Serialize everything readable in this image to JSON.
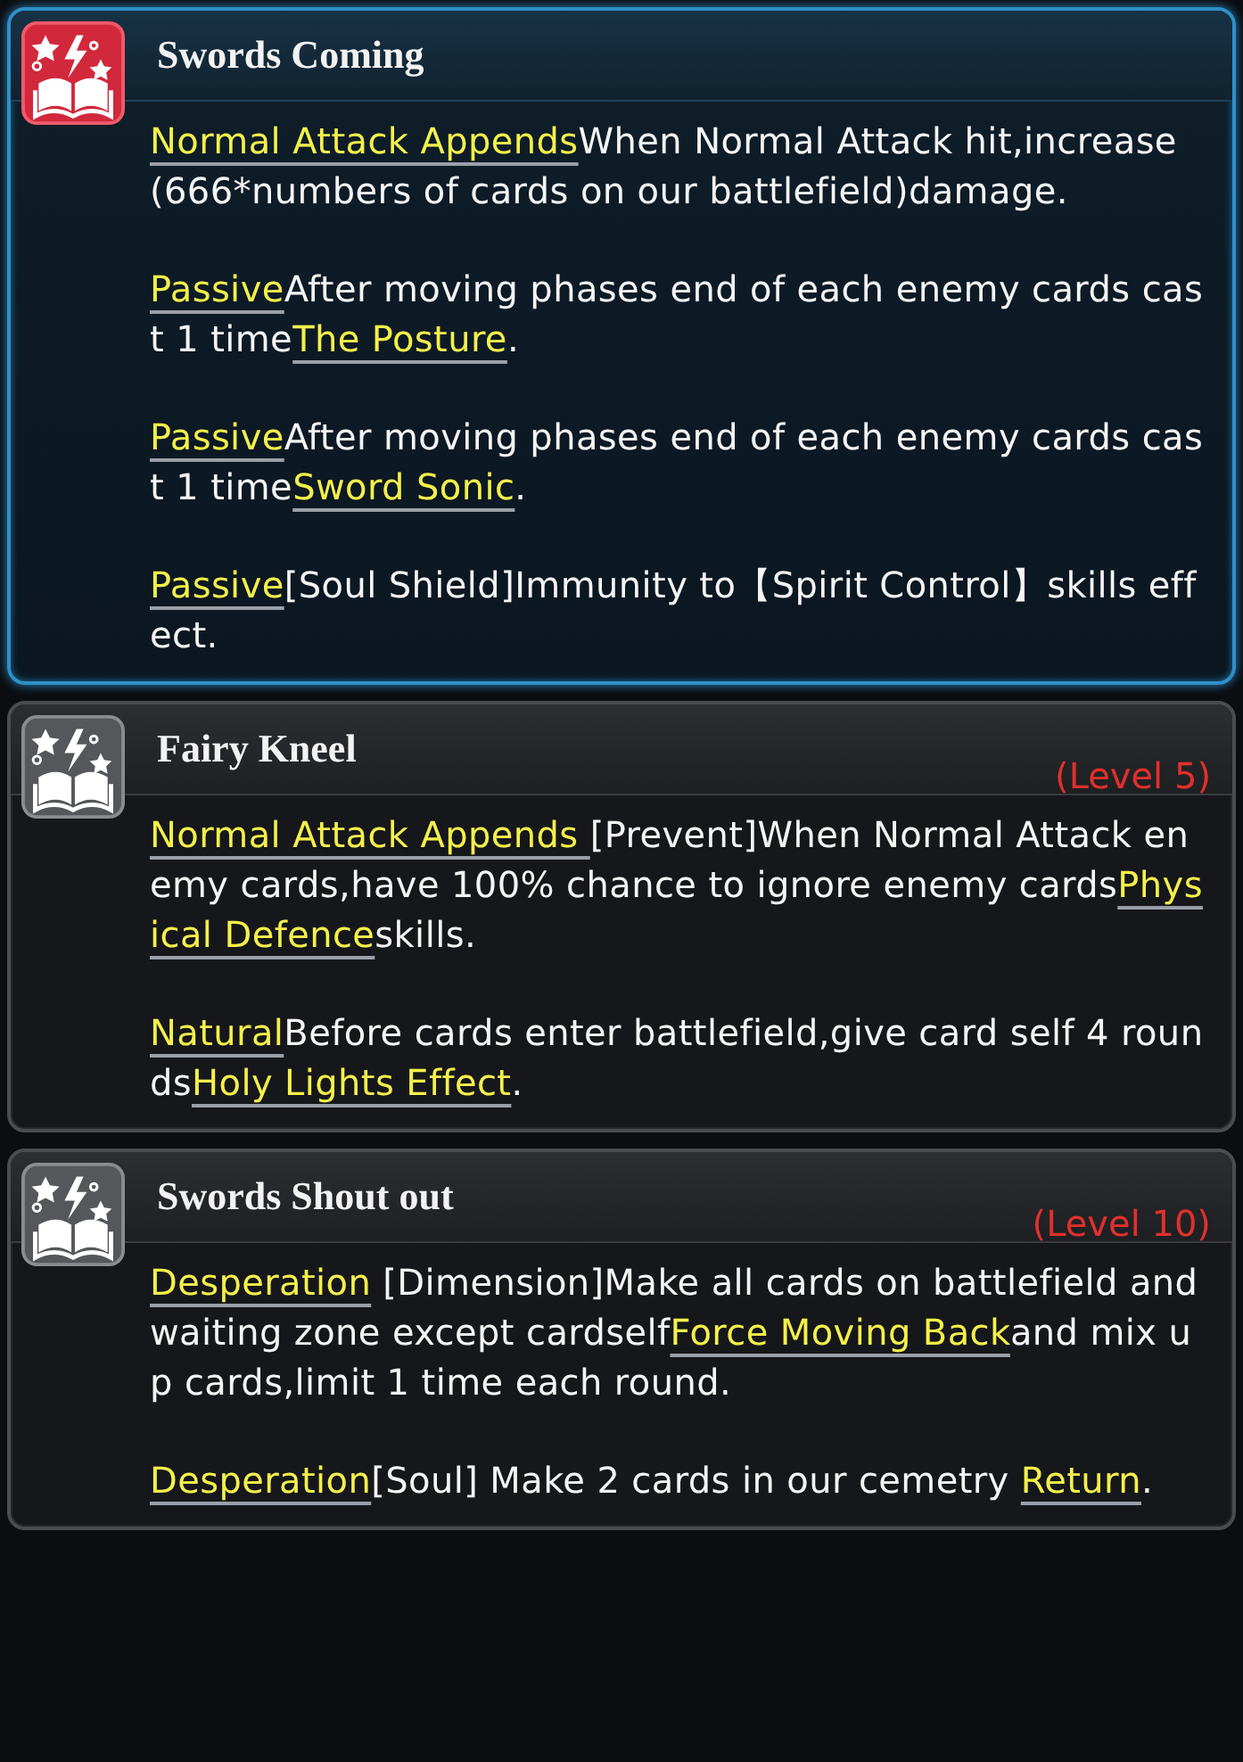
{
  "skills": [
    {
      "title": "Swords Coming",
      "selected": true,
      "paragraphs": [
        [
          {
            "kind": "term",
            "text": "Normal Attack Appends"
          },
          {
            "kind": "text",
            "text": "When Normal Attack hit,increase(666*numbers of cards on our battlefield)damage."
          }
        ],
        [
          {
            "kind": "term",
            "text": "Passive"
          },
          {
            "kind": "text",
            "text": "After moving phases end of each enemy cards cast 1 time"
          },
          {
            "kind": "term",
            "text": "The Posture"
          },
          {
            "kind": "text",
            "text": "."
          }
        ],
        [
          {
            "kind": "term",
            "text": "Passive"
          },
          {
            "kind": "text",
            "text": "After moving phases end of each enemy cards cast 1 time"
          },
          {
            "kind": "term",
            "text": "Sword Sonic"
          },
          {
            "kind": "text",
            "text": "."
          }
        ],
        [
          {
            "kind": "term",
            "text": "Passive"
          },
          {
            "kind": "text",
            "text": "[Soul Shield]Immunity to【Spirit Control】skills effect."
          }
        ]
      ]
    },
    {
      "title": "Fairy Kneel",
      "selected": false,
      "level": "(Level 5)",
      "paragraphs": [
        [
          {
            "kind": "term",
            "text": "Normal Attack Appends "
          },
          {
            "kind": "text",
            "text": "[Prevent]When Normal Attack enemy cards,have 100% chance to ignore enemy cards"
          },
          {
            "kind": "term",
            "text": "Physical Defence"
          },
          {
            "kind": "text",
            "text": "skills."
          }
        ],
        [
          {
            "kind": "term",
            "text": "Natural"
          },
          {
            "kind": "text",
            "text": "Before cards enter battlefield,give card self 4 rounds"
          },
          {
            "kind": "term",
            "text": "Holy Lights Effect"
          },
          {
            "kind": "text",
            "text": "."
          }
        ]
      ]
    },
    {
      "title": "Swords Shout out",
      "selected": false,
      "level": "(Level 10)",
      "paragraphs": [
        [
          {
            "kind": "term",
            "text": "Desperation"
          },
          {
            "kind": "text",
            "text": " [Dimension]Make all cards on battlefield and waiting zone except cardself"
          },
          {
            "kind": "term",
            "text": "Force Moving Back"
          },
          {
            "kind": "text",
            "text": "and mix up cards,limit 1 time each round."
          }
        ],
        [
          {
            "kind": "term",
            "text": "Desperation"
          },
          {
            "kind": "text",
            "text": "[Soul] Make 2 cards in our cemetry "
          },
          {
            "kind": "term",
            "text": "Return"
          },
          {
            "kind": "text",
            "text": "."
          }
        ]
      ]
    }
  ]
}
